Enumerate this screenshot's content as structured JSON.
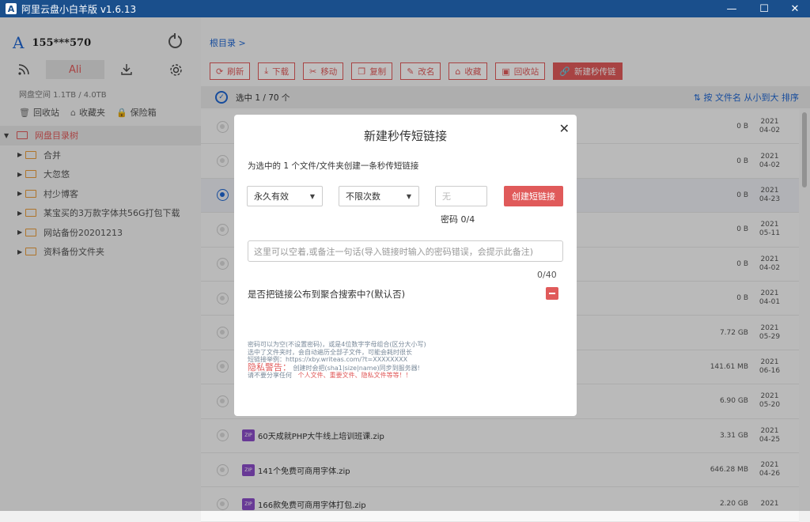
{
  "window": {
    "title": "阿里云盘小白羊版 v1.6.13",
    "logo": "A",
    "minimize": "—",
    "maximize": "☐",
    "close": "✕"
  },
  "sidebar": {
    "user": "155***570",
    "logo_letter": "A",
    "nav": {
      "rss": "rss-icon",
      "ali": "Ali",
      "download": "download-icon",
      "settings": "gear-icon"
    },
    "space": "网盘空间 1.1TB / 4.0TB",
    "quick": [
      "回收站",
      "收藏夹",
      "保险箱"
    ],
    "tree_root": "网盘目录树",
    "tree": [
      "合并",
      "大忽悠",
      "村少博客",
      "某宝买的3万款字体共56G打包下载",
      "网站备份20201213",
      "资料备份文件夹"
    ]
  },
  "main": {
    "breadcrumb": "根目录 >",
    "toolbar": [
      "刷新",
      "下载",
      "移动",
      "复制",
      "改名",
      "收藏",
      "回收站",
      "新建秒传链"
    ],
    "selected": "选中 1 / 70 个",
    "sort": "按 文件名 从小到大 排序",
    "rows": [
      {
        "name": "",
        "size": "0 B",
        "year": "2021",
        "date": "04-02"
      },
      {
        "name": "",
        "size": "0 B",
        "year": "2021",
        "date": "04-02"
      },
      {
        "name": "",
        "size": "0 B",
        "year": "2021",
        "date": "04-23"
      },
      {
        "name": "",
        "size": "0 B",
        "year": "2021",
        "date": "05-11"
      },
      {
        "name": "",
        "size": "0 B",
        "year": "2021",
        "date": "04-02"
      },
      {
        "name": "",
        "size": "0 B",
        "year": "2021",
        "date": "04-01"
      },
      {
        "name": "",
        "size": "7.72 GB",
        "year": "2021",
        "date": "05-29"
      },
      {
        "name": "",
        "size": "141.61 MB",
        "year": "2021",
        "date": "06-16"
      },
      {
        "name": "",
        "size": "6.90 GB",
        "year": "2021",
        "date": "05-20"
      },
      {
        "name": "60天成就PHP大牛线上培训班课.zip",
        "size": "3.31 GB",
        "year": "2021",
        "date": "04-25"
      },
      {
        "name": "141个免费可商用字体.zip",
        "size": "646.28 MB",
        "year": "2021",
        "date": "04-26"
      },
      {
        "name": "166款免费可商用字体打包.zip",
        "size": "2.20 GB",
        "year": "2021",
        "date": ""
      }
    ]
  },
  "dialog": {
    "title": "新建秒传短链接",
    "desc": "为选中的 1 个文件/文件夹创建一条秒传短链接",
    "expire": "永久有效",
    "limit": "不限次数",
    "pwd_placeholder": "无",
    "create": "创建短链接",
    "pwd_label": "密码   0/4",
    "note_placeholder": "这里可以空着,或备注一句话(导入链接时输入的密码错误，会提示此备注)",
    "note_count": "0/40",
    "publish": "是否把链接公布到聚合搜索中?(默认否)",
    "tips1": "密码可以为空(不设置密码)，或是4位数字字母组合(区分大小写)",
    "tips2": "选中了文件夹时，会自动遍历全部子文件，可能会耗时很长",
    "tips3": "短链接举例：https://xby.writeas.com/?t=XXXXXXXX",
    "warn": "隐私警告：",
    "warn_text": "创建时会把(sha1|size|name)同步到服务器!",
    "tips5": "请不要分享任何",
    "tips5_red": "个人文件、重要文件、隐私文件等等！！"
  }
}
